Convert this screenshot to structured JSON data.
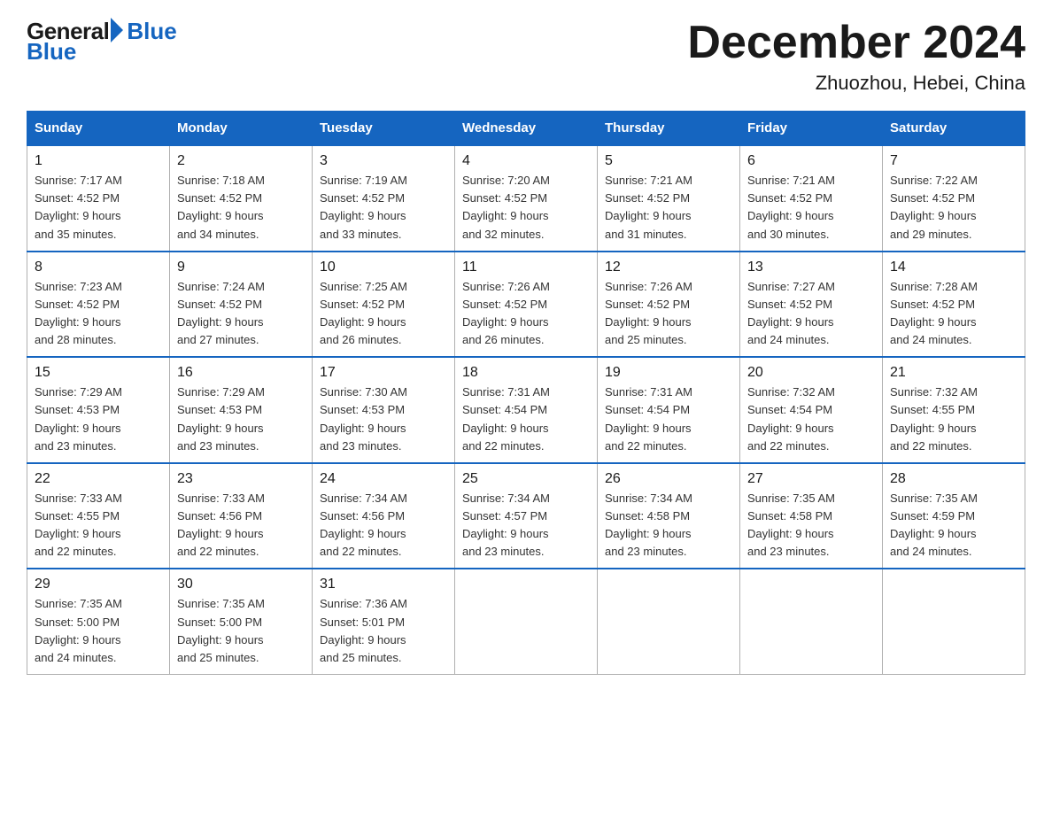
{
  "logo": {
    "general": "General",
    "blue": "Blue"
  },
  "title": "December 2024",
  "location": "Zhuozhou, Hebei, China",
  "days_of_week": [
    "Sunday",
    "Monday",
    "Tuesday",
    "Wednesday",
    "Thursday",
    "Friday",
    "Saturday"
  ],
  "weeks": [
    [
      {
        "day": "1",
        "sunrise": "7:17 AM",
        "sunset": "4:52 PM",
        "daylight": "9 hours and 35 minutes."
      },
      {
        "day": "2",
        "sunrise": "7:18 AM",
        "sunset": "4:52 PM",
        "daylight": "9 hours and 34 minutes."
      },
      {
        "day": "3",
        "sunrise": "7:19 AM",
        "sunset": "4:52 PM",
        "daylight": "9 hours and 33 minutes."
      },
      {
        "day": "4",
        "sunrise": "7:20 AM",
        "sunset": "4:52 PM",
        "daylight": "9 hours and 32 minutes."
      },
      {
        "day": "5",
        "sunrise": "7:21 AM",
        "sunset": "4:52 PM",
        "daylight": "9 hours and 31 minutes."
      },
      {
        "day": "6",
        "sunrise": "7:21 AM",
        "sunset": "4:52 PM",
        "daylight": "9 hours and 30 minutes."
      },
      {
        "day": "7",
        "sunrise": "7:22 AM",
        "sunset": "4:52 PM",
        "daylight": "9 hours and 29 minutes."
      }
    ],
    [
      {
        "day": "8",
        "sunrise": "7:23 AM",
        "sunset": "4:52 PM",
        "daylight": "9 hours and 28 minutes."
      },
      {
        "day": "9",
        "sunrise": "7:24 AM",
        "sunset": "4:52 PM",
        "daylight": "9 hours and 27 minutes."
      },
      {
        "day": "10",
        "sunrise": "7:25 AM",
        "sunset": "4:52 PM",
        "daylight": "9 hours and 26 minutes."
      },
      {
        "day": "11",
        "sunrise": "7:26 AM",
        "sunset": "4:52 PM",
        "daylight": "9 hours and 26 minutes."
      },
      {
        "day": "12",
        "sunrise": "7:26 AM",
        "sunset": "4:52 PM",
        "daylight": "9 hours and 25 minutes."
      },
      {
        "day": "13",
        "sunrise": "7:27 AM",
        "sunset": "4:52 PM",
        "daylight": "9 hours and 24 minutes."
      },
      {
        "day": "14",
        "sunrise": "7:28 AM",
        "sunset": "4:52 PM",
        "daylight": "9 hours and 24 minutes."
      }
    ],
    [
      {
        "day": "15",
        "sunrise": "7:29 AM",
        "sunset": "4:53 PM",
        "daylight": "9 hours and 23 minutes."
      },
      {
        "day": "16",
        "sunrise": "7:29 AM",
        "sunset": "4:53 PM",
        "daylight": "9 hours and 23 minutes."
      },
      {
        "day": "17",
        "sunrise": "7:30 AM",
        "sunset": "4:53 PM",
        "daylight": "9 hours and 23 minutes."
      },
      {
        "day": "18",
        "sunrise": "7:31 AM",
        "sunset": "4:54 PM",
        "daylight": "9 hours and 22 minutes."
      },
      {
        "day": "19",
        "sunrise": "7:31 AM",
        "sunset": "4:54 PM",
        "daylight": "9 hours and 22 minutes."
      },
      {
        "day": "20",
        "sunrise": "7:32 AM",
        "sunset": "4:54 PM",
        "daylight": "9 hours and 22 minutes."
      },
      {
        "day": "21",
        "sunrise": "7:32 AM",
        "sunset": "4:55 PM",
        "daylight": "9 hours and 22 minutes."
      }
    ],
    [
      {
        "day": "22",
        "sunrise": "7:33 AM",
        "sunset": "4:55 PM",
        "daylight": "9 hours and 22 minutes."
      },
      {
        "day": "23",
        "sunrise": "7:33 AM",
        "sunset": "4:56 PM",
        "daylight": "9 hours and 22 minutes."
      },
      {
        "day": "24",
        "sunrise": "7:34 AM",
        "sunset": "4:56 PM",
        "daylight": "9 hours and 22 minutes."
      },
      {
        "day": "25",
        "sunrise": "7:34 AM",
        "sunset": "4:57 PM",
        "daylight": "9 hours and 23 minutes."
      },
      {
        "day": "26",
        "sunrise": "7:34 AM",
        "sunset": "4:58 PM",
        "daylight": "9 hours and 23 minutes."
      },
      {
        "day": "27",
        "sunrise": "7:35 AM",
        "sunset": "4:58 PM",
        "daylight": "9 hours and 23 minutes."
      },
      {
        "day": "28",
        "sunrise": "7:35 AM",
        "sunset": "4:59 PM",
        "daylight": "9 hours and 24 minutes."
      }
    ],
    [
      {
        "day": "29",
        "sunrise": "7:35 AM",
        "sunset": "5:00 PM",
        "daylight": "9 hours and 24 minutes."
      },
      {
        "day": "30",
        "sunrise": "7:35 AM",
        "sunset": "5:00 PM",
        "daylight": "9 hours and 25 minutes."
      },
      {
        "day": "31",
        "sunrise": "7:36 AM",
        "sunset": "5:01 PM",
        "daylight": "9 hours and 25 minutes."
      },
      null,
      null,
      null,
      null
    ]
  ],
  "labels": {
    "sunrise": "Sunrise:",
    "sunset": "Sunset:",
    "daylight": "Daylight:"
  }
}
